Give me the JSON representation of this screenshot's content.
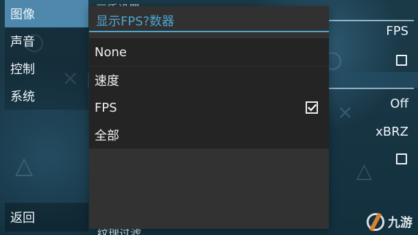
{
  "background": {
    "symbols": [
      "○",
      "×",
      "△",
      "○",
      "△",
      "×"
    ]
  },
  "sidebar": {
    "items": [
      {
        "label": "图像",
        "active": true
      },
      {
        "label": "声音",
        "active": false
      },
      {
        "label": "控制",
        "active": false
      },
      {
        "label": "系统",
        "active": false
      }
    ],
    "back_label": "返回"
  },
  "settings": {
    "top_partial_label": "画质设置",
    "right_values": [
      "FPS",
      "Off",
      "xBRZ"
    ],
    "bottom_partial_label": "纹理过滤"
  },
  "dialog": {
    "title": "显示FPS?数器",
    "options": [
      {
        "label": "None",
        "checked": false
      },
      {
        "label": "速度",
        "checked": false
      },
      {
        "label": "FPS",
        "checked": true
      },
      {
        "label": "全部",
        "checked": false
      }
    ]
  },
  "watermark": {
    "label": "九游"
  },
  "colors": {
    "accent": "#4da6d1",
    "selected_tab": "#5896be",
    "dialog_background": "#323232",
    "option_background": "#242424"
  }
}
